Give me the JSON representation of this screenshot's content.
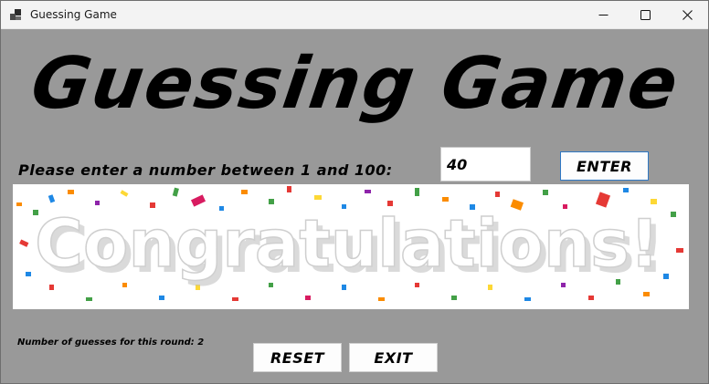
{
  "window": {
    "title": "Guessing Game",
    "controls": {
      "minimize_icon": "minimize-icon",
      "maximize_icon": "maximize-icon",
      "close_icon": "close-icon"
    }
  },
  "main": {
    "heading": "Guessing Game",
    "prompt": "Please enter a number between 1 and 100:",
    "guess_input": {
      "value": "40"
    },
    "enter_label": "ENTER",
    "banner": {
      "text": "Congratulations!"
    },
    "guess_count_text": "Number of guesses for this round: 2",
    "reset_label": "RESET",
    "exit_label": "EXIT"
  },
  "colors": {
    "form_background": "#999999",
    "enter_border": "#2f78c4"
  }
}
